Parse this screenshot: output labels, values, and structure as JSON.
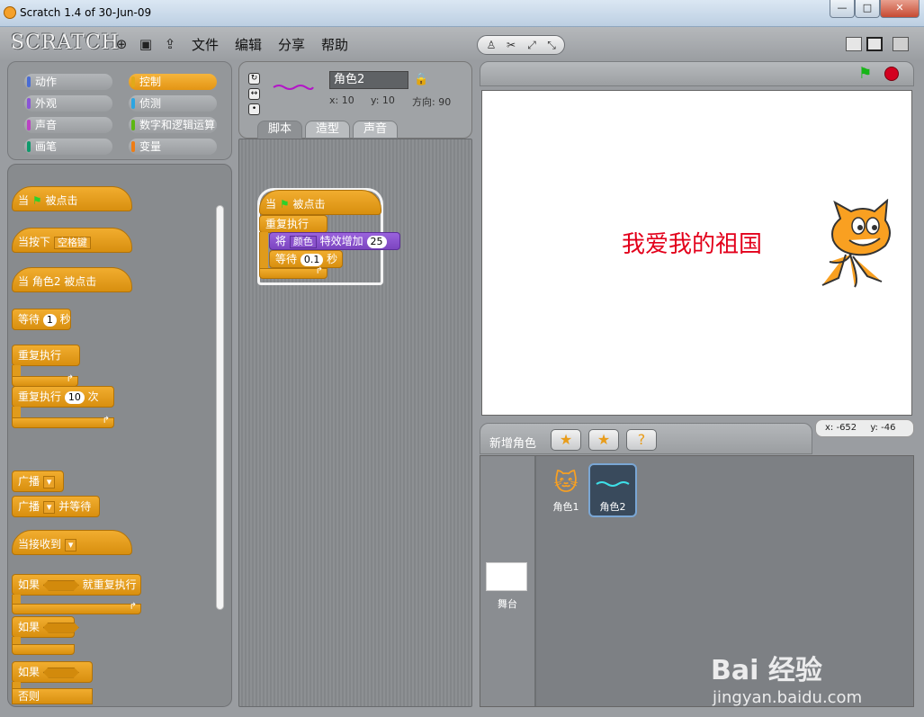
{
  "window": {
    "title": "Scratch 1.4 of 30-Jun-09",
    "minimize": "—",
    "maximize": "□",
    "close": "✕"
  },
  "menubar": {
    "logo": "SCRATCH",
    "menus": [
      "文件",
      "编辑",
      "分享",
      "帮助"
    ]
  },
  "categories": [
    {
      "label": "动作",
      "color": "#4a6cd4"
    },
    {
      "label": "控制",
      "color": "#e1a91a"
    },
    {
      "label": "外观",
      "color": "#8a55d7"
    },
    {
      "label": "侦测",
      "color": "#2ca5e2"
    },
    {
      "label": "声音",
      "color": "#bb42c3"
    },
    {
      "label": "数字和逻辑运算",
      "color": "#5cb712"
    },
    {
      "label": "画笔",
      "color": "#0e9a6c"
    },
    {
      "label": "变量",
      "color": "#ee7d16"
    }
  ],
  "palette": {
    "when_flag": {
      "a": "当",
      "b": "被点击"
    },
    "when_key": {
      "a": "当按下",
      "key": "空格键"
    },
    "when_sprite": "当 角色2 被点击",
    "wait": {
      "a": "等待",
      "n": "1",
      "b": "秒"
    },
    "forever": "重复执行",
    "repeat": {
      "a": "重复执行",
      "n": "10",
      "b": "次"
    },
    "broadcast": "广播",
    "broadcast_wait": {
      "a": "广播",
      "b": "并等待"
    },
    "when_receive": "当接收到",
    "forever_if": {
      "a": "如果",
      "b": "就重复执行"
    },
    "if": "如果",
    "if_else": {
      "a": "如果",
      "b": "否则"
    }
  },
  "sprite_info": {
    "name": "角色2",
    "x": "x: 10",
    "y": "y: 10",
    "direction": "方向: 90"
  },
  "tabs": [
    "脚本",
    "造型",
    "声音"
  ],
  "script": {
    "hat": {
      "a": "当",
      "b": "被点击"
    },
    "forever": "重复执行",
    "effect": {
      "a": "将",
      "effect": "颜色",
      "b": "特效增加",
      "n": "25"
    },
    "wait": {
      "a": "等待",
      "n": "0.1",
      "b": "秒"
    }
  },
  "stage": {
    "text": "我爱我的祖国"
  },
  "coords": {
    "x": "x: -652",
    "y": "y: -46"
  },
  "new_sprite": {
    "label": "新增角色"
  },
  "sprites": [
    {
      "name": "角色1"
    },
    {
      "name": "角色2"
    }
  ],
  "stage_thumb": "舞台",
  "watermark": {
    "brand": "Bai 经验",
    "url": "jingyan.baidu.com"
  }
}
